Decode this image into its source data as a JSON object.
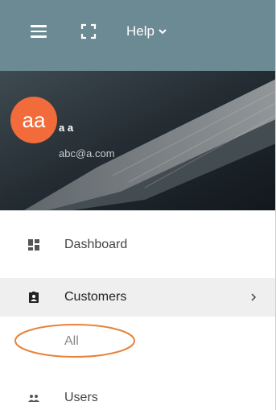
{
  "topbar": {
    "menu_icon": "hamburger-menu-icon",
    "fullscreen_icon": "fullscreen-icon",
    "help_label": "Help",
    "help_chevron_icon": "chevron-down-icon",
    "background_color": "#6c8a94"
  },
  "profile": {
    "avatar_initials": "aa",
    "avatar_color": "#f26b3a",
    "name": "a a",
    "email": "abc@a.com"
  },
  "nav": {
    "items": [
      {
        "label": "Dashboard",
        "icon": "dashboard-grid-icon"
      },
      {
        "label": "Customers",
        "icon": "customers-badge-icon",
        "expanded": true,
        "arrow_icon": "chevron-right-icon"
      },
      {
        "label": "All",
        "submenu": true,
        "highlighted": true
      },
      {
        "label": "Users",
        "icon": "users-group-icon"
      }
    ]
  },
  "annotation": {
    "highlight_color": "#e8833a"
  }
}
